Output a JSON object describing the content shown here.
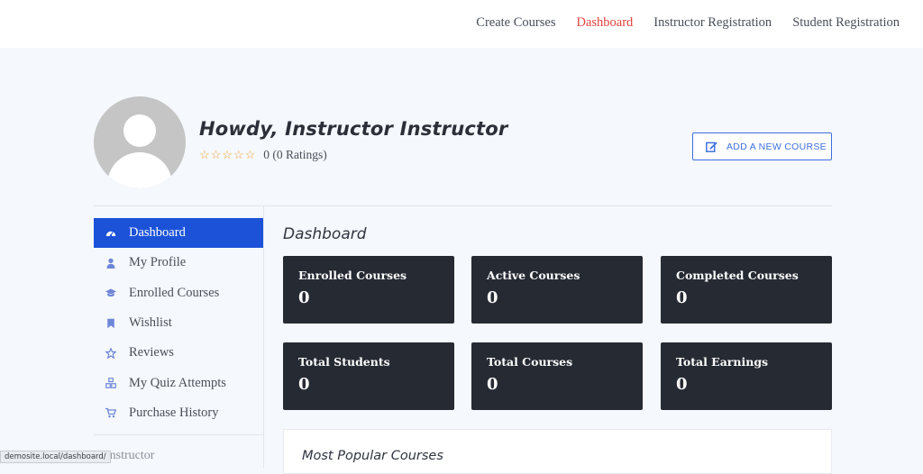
{
  "topnav": {
    "items": [
      {
        "label": "Create Courses",
        "active": false
      },
      {
        "label": "Dashboard",
        "active": true
      },
      {
        "label": "Instructor Registration",
        "active": false
      },
      {
        "label": "Student Registration",
        "active": false
      }
    ]
  },
  "profile": {
    "greeting": "Howdy, Instructor Instructor",
    "stars": "☆☆☆☆☆",
    "rating_text": "0 (0 Ratings)"
  },
  "actions": {
    "add_course_label": "ADD A NEW COURSE"
  },
  "sidebar": {
    "items": [
      {
        "label": "Dashboard",
        "icon": "dashboard-icon",
        "active": true
      },
      {
        "label": "My Profile",
        "icon": "user-icon",
        "active": false
      },
      {
        "label": "Enrolled Courses",
        "icon": "graduation-cap-icon",
        "active": false
      },
      {
        "label": "Wishlist",
        "icon": "bookmark-icon",
        "active": false
      },
      {
        "label": "Reviews",
        "icon": "star-icon",
        "active": false
      },
      {
        "label": "My Quiz Attempts",
        "icon": "quiz-icon",
        "active": false
      },
      {
        "label": "Purchase History",
        "icon": "cart-icon",
        "active": false
      }
    ],
    "section_label": "Instructor"
  },
  "main": {
    "title": "Dashboard",
    "cards": [
      {
        "label": "Enrolled Courses",
        "value": "0"
      },
      {
        "label": "Active Courses",
        "value": "0"
      },
      {
        "label": "Completed Courses",
        "value": "0"
      },
      {
        "label": "Total Students",
        "value": "0"
      },
      {
        "label": "Total Courses",
        "value": "0"
      },
      {
        "label": "Total Earnings",
        "value": "0"
      }
    ],
    "popular_title": "Most Popular Courses"
  },
  "status_bar": {
    "url": "demosite.local/dashboard/"
  },
  "colors": {
    "accent": "#1b52d8",
    "active_nav": "#e4413c",
    "card_bg": "#262a33",
    "star": "#f1a23a"
  }
}
